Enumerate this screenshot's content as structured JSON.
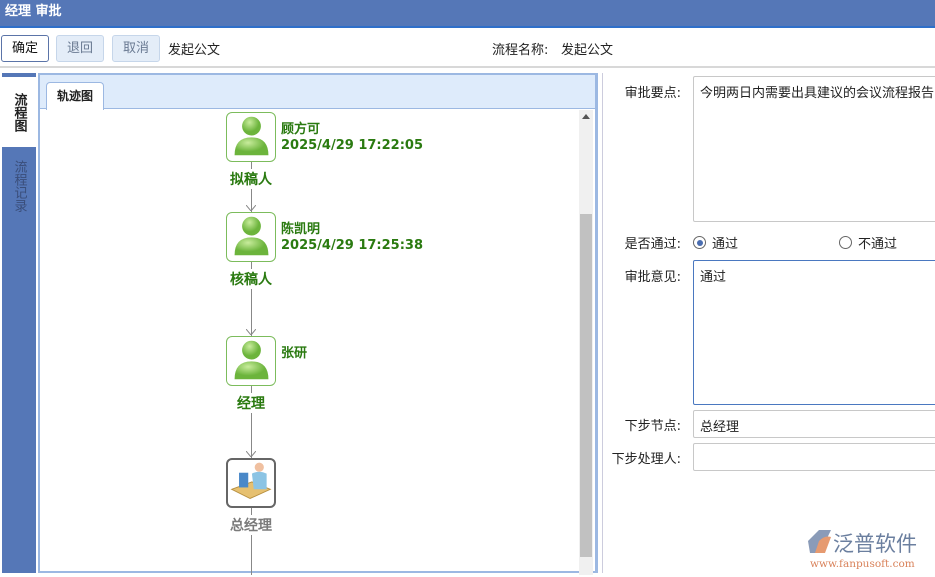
{
  "title": "经理 审批",
  "toolbar": {
    "confirm": "确定",
    "return": "退回",
    "cancel": "取消",
    "flow_title": "发起公文",
    "flow_name_label": "流程名称:",
    "flow_name_value": "发起公文"
  },
  "side_tabs": [
    {
      "label": "流程图",
      "active": true
    },
    {
      "label": "流程记录",
      "active": false
    }
  ],
  "panel_tab": "轨迹图",
  "nodes": [
    {
      "role": "拟稿人",
      "name": "顾方可",
      "time": "2025/4/29 17:22:05",
      "status": "done"
    },
    {
      "role": "核稿人",
      "name": "陈凯明",
      "time": "2025/4/29 17:25:38",
      "status": "done"
    },
    {
      "role": "经理",
      "name": "张研",
      "time": "",
      "status": "done"
    },
    {
      "role": "总经理",
      "name": "",
      "time": "",
      "status": "pending"
    }
  ],
  "form": {
    "key_points_label": "审批要点:",
    "key_points_value": "今明两日内需要出具建议的会议流程报告",
    "pass_label": "是否通过:",
    "pass_option": "通过",
    "fail_option": "不通过",
    "selected": "通过",
    "opinion_label": "审批意见:",
    "opinion_value": "通过",
    "next_node_label": "下步节点:",
    "next_node_value": "总经理",
    "next_handler_label": "下步处理人:",
    "next_handler_value": ""
  },
  "logo": {
    "text": "泛普软件",
    "url": "www.fanpusoft.com"
  },
  "colors": {
    "titlebar": "#5577b7",
    "node_done": "#2a7a10",
    "node_pending": "#7a7a7a"
  }
}
